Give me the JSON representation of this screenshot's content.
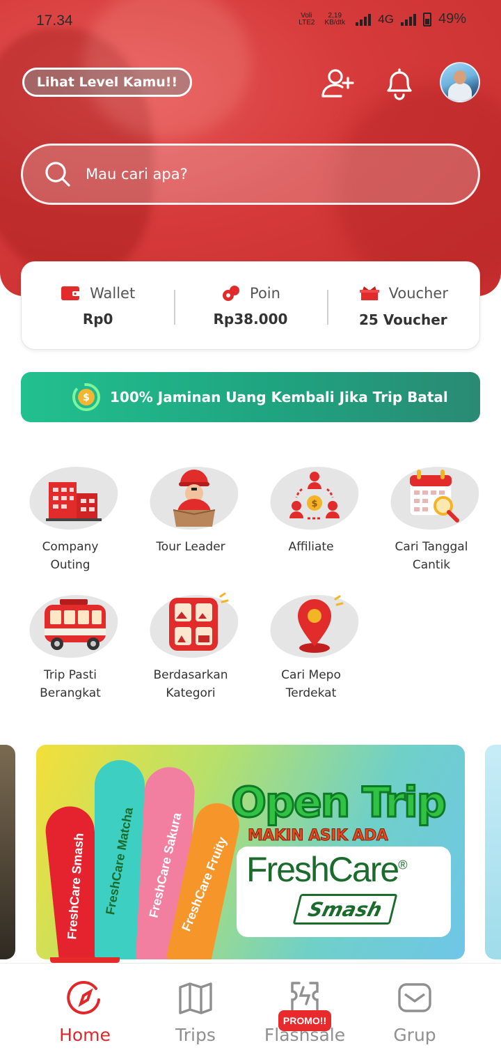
{
  "status_bar": {
    "time": "17.34",
    "volte": "Voli LTE2",
    "speed": "2,19 KB/dtk",
    "network": "4G",
    "battery": "49%"
  },
  "header": {
    "level_button": "Lihat Level Kamu!!",
    "icons": [
      "add-friend-icon",
      "notification-bell-icon",
      "profile-avatar"
    ]
  },
  "search": {
    "placeholder": "Mau cari apa?"
  },
  "balance": {
    "wallet": {
      "label": "Wallet",
      "value": "Rp0"
    },
    "poin": {
      "label": "Poin",
      "value": "Rp38.000"
    },
    "voucher": {
      "label": "Voucher",
      "value": "25 Voucher"
    }
  },
  "guarantee": {
    "text": "100% Jaminan Uang Kembali Jika Trip Batal"
  },
  "menu": [
    {
      "label1": "Company",
      "label2": "Outing",
      "icon": "building-icon"
    },
    {
      "label1": "Tour Leader",
      "label2": "",
      "icon": "tour-leader-icon"
    },
    {
      "label1": "Affiliate",
      "label2": "",
      "icon": "affiliate-icon"
    },
    {
      "label1": "Cari Tanggal",
      "label2": "Cantik",
      "icon": "calendar-search-icon"
    },
    {
      "label1": "Trip Pasti",
      "label2": "Berangkat",
      "icon": "bus-icon"
    },
    {
      "label1": "Berdasarkan",
      "label2": "Kategori",
      "icon": "category-icon"
    },
    {
      "label1": "Cari Mepo",
      "label2": "Terdekat",
      "icon": "location-pin-icon"
    }
  ],
  "banner": {
    "title": "Open Trip",
    "subtitle": "MAKIN ASIK ADA",
    "brand": "FreshCare",
    "reg": "®",
    "product": "Smash",
    "sticks": [
      "FreshCare Smash",
      "FreshCare Matcha",
      "FreshCare Sakura",
      "FreshCare Fruity"
    ]
  },
  "bottom_nav": {
    "home": "Home",
    "trips": "Trips",
    "flashsale": "Flashsale",
    "grup": "Grup",
    "promo_badge": "PROMO!!"
  },
  "colors": {
    "brand_red": "#e0272a",
    "guarantee_green": "#1fa480",
    "inactive_nav": "#8f8f8f"
  }
}
